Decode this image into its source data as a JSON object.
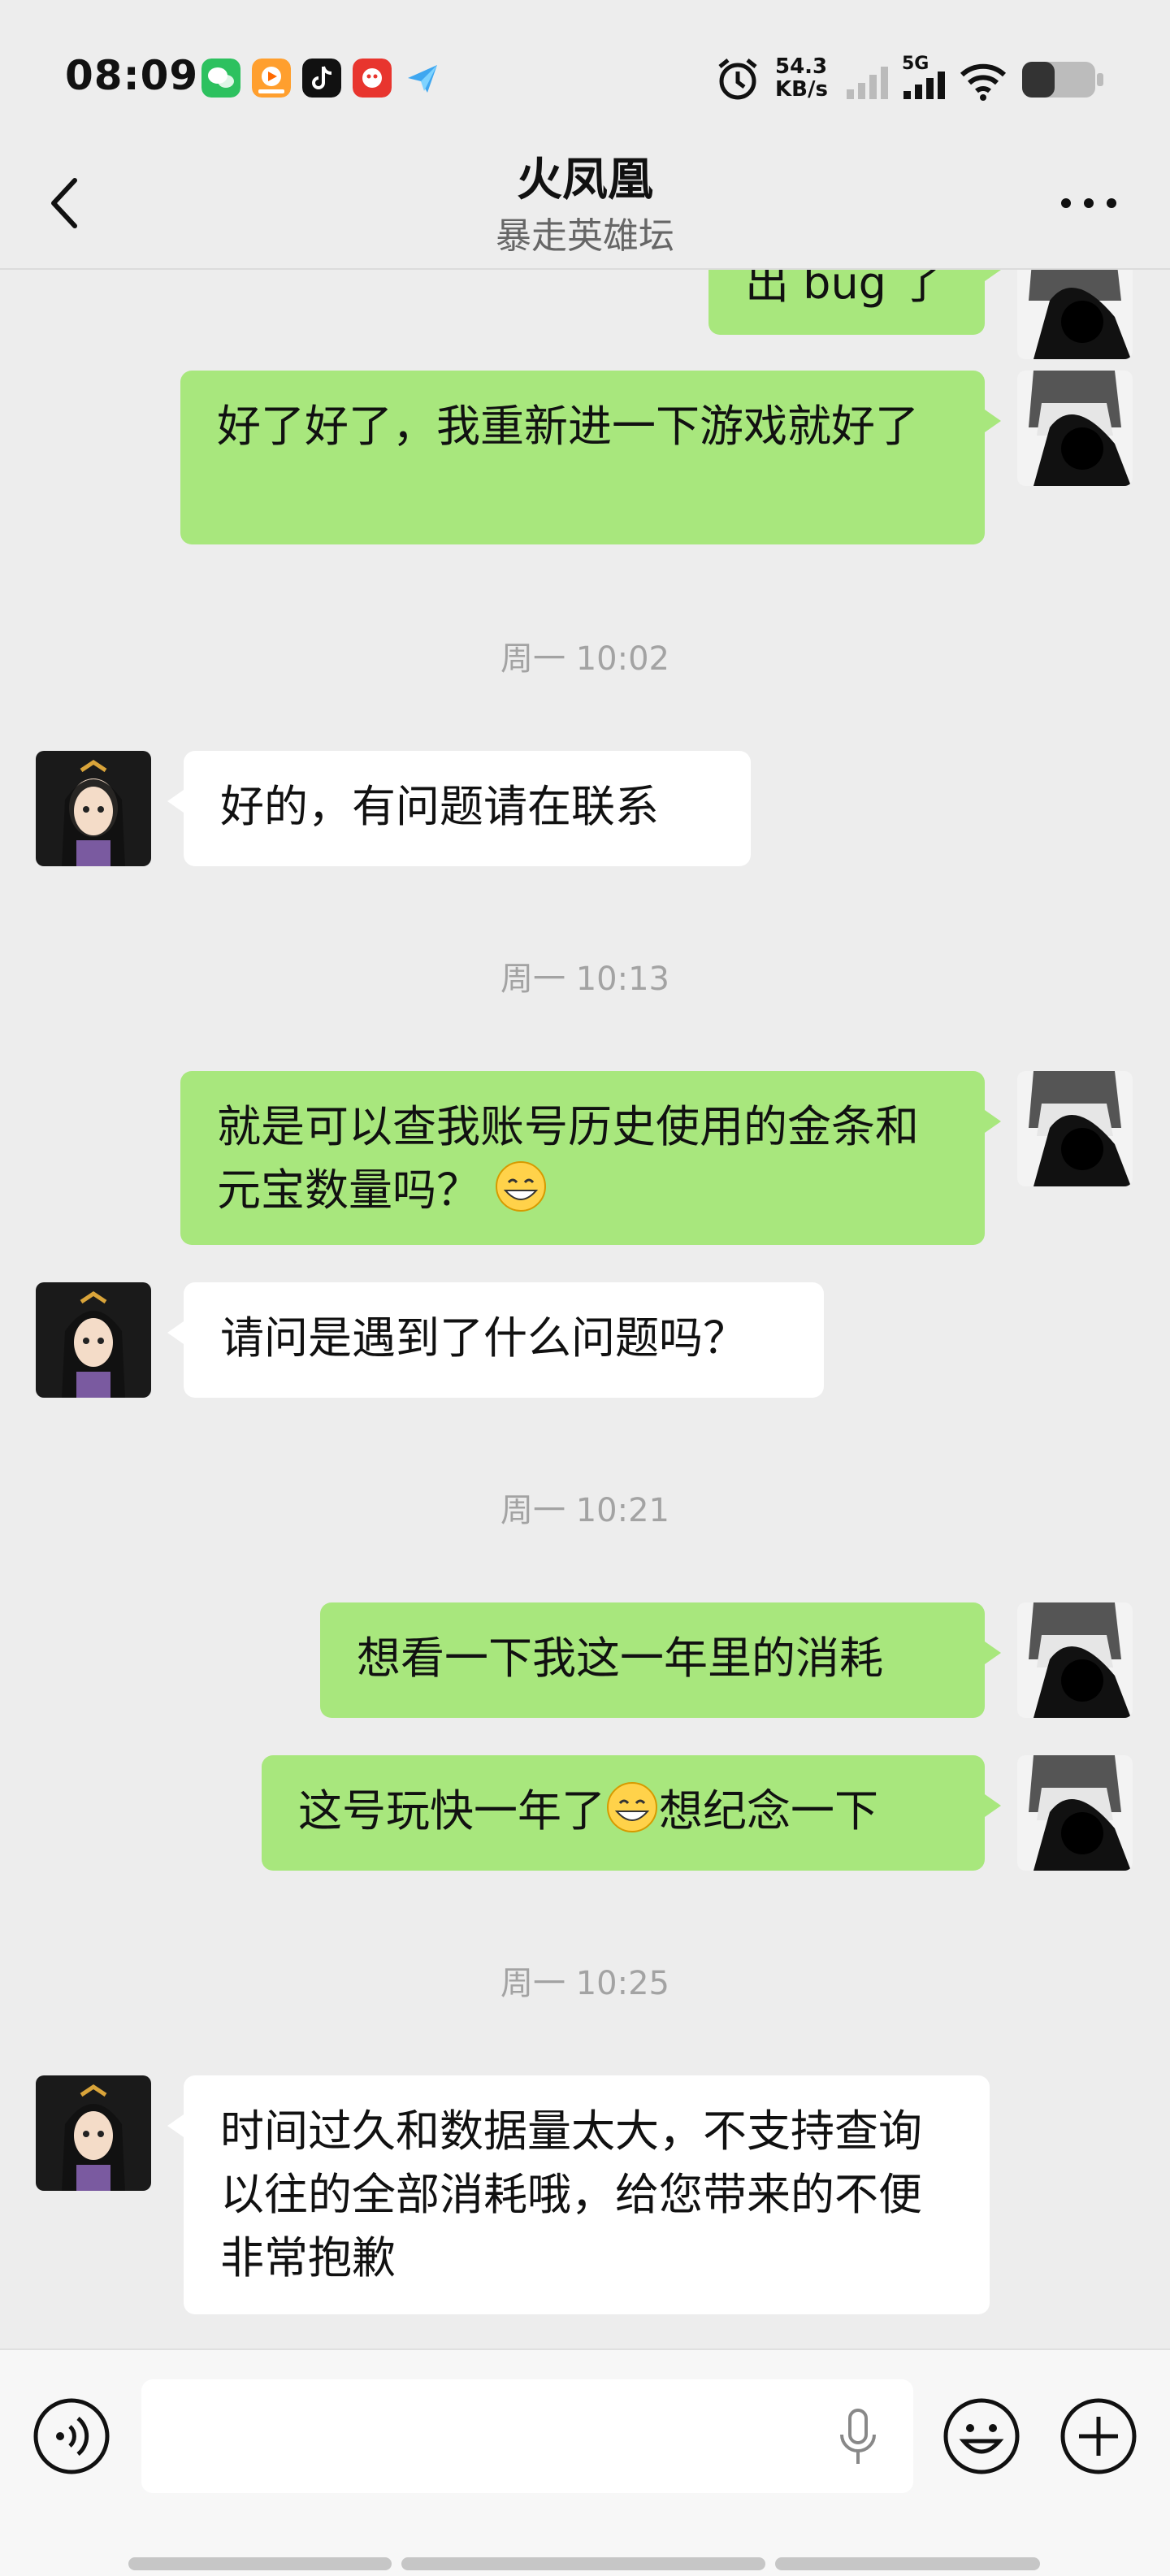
{
  "status_bar": {
    "time": "08:09",
    "net_speed_value": "54.3",
    "net_speed_unit": "KB/s",
    "network_label": "5G",
    "apps": [
      "wechat-icon",
      "video-app-icon",
      "tiktok-icon",
      "red-app-icon",
      "send-app-icon"
    ]
  },
  "header": {
    "title": "火凤凰",
    "subtitle": "暴走英雄坛"
  },
  "chat": {
    "msg_0_partial": "出 bug 了",
    "msg_1": "好了好了，我重新进一下游戏就好了",
    "ts_1": "周一 10:02",
    "msg_2": "好的，有问题请在联系",
    "ts_2": "周一 10:13",
    "msg_3_a": "就是可以查我账号历史使用的金条和元宝数量吗？",
    "msg_4": "请问是遇到了什么问题吗？",
    "ts_3": "周一 10:21",
    "msg_5": "想看一下我这一年里的消耗",
    "msg_6_a": "这号玩快一年了",
    "msg_6_b": "想纪念一下",
    "ts_4": "周一 10:25",
    "msg_7": "时间过久和数据量太大，不支持查询以往的全部消耗哦，给您带来的不便非常抱歉"
  },
  "input": {
    "placeholder": ""
  },
  "colors": {
    "my_bubble": "#a8e77d",
    "their_bubble": "#ffffff",
    "background": "#ededed"
  }
}
